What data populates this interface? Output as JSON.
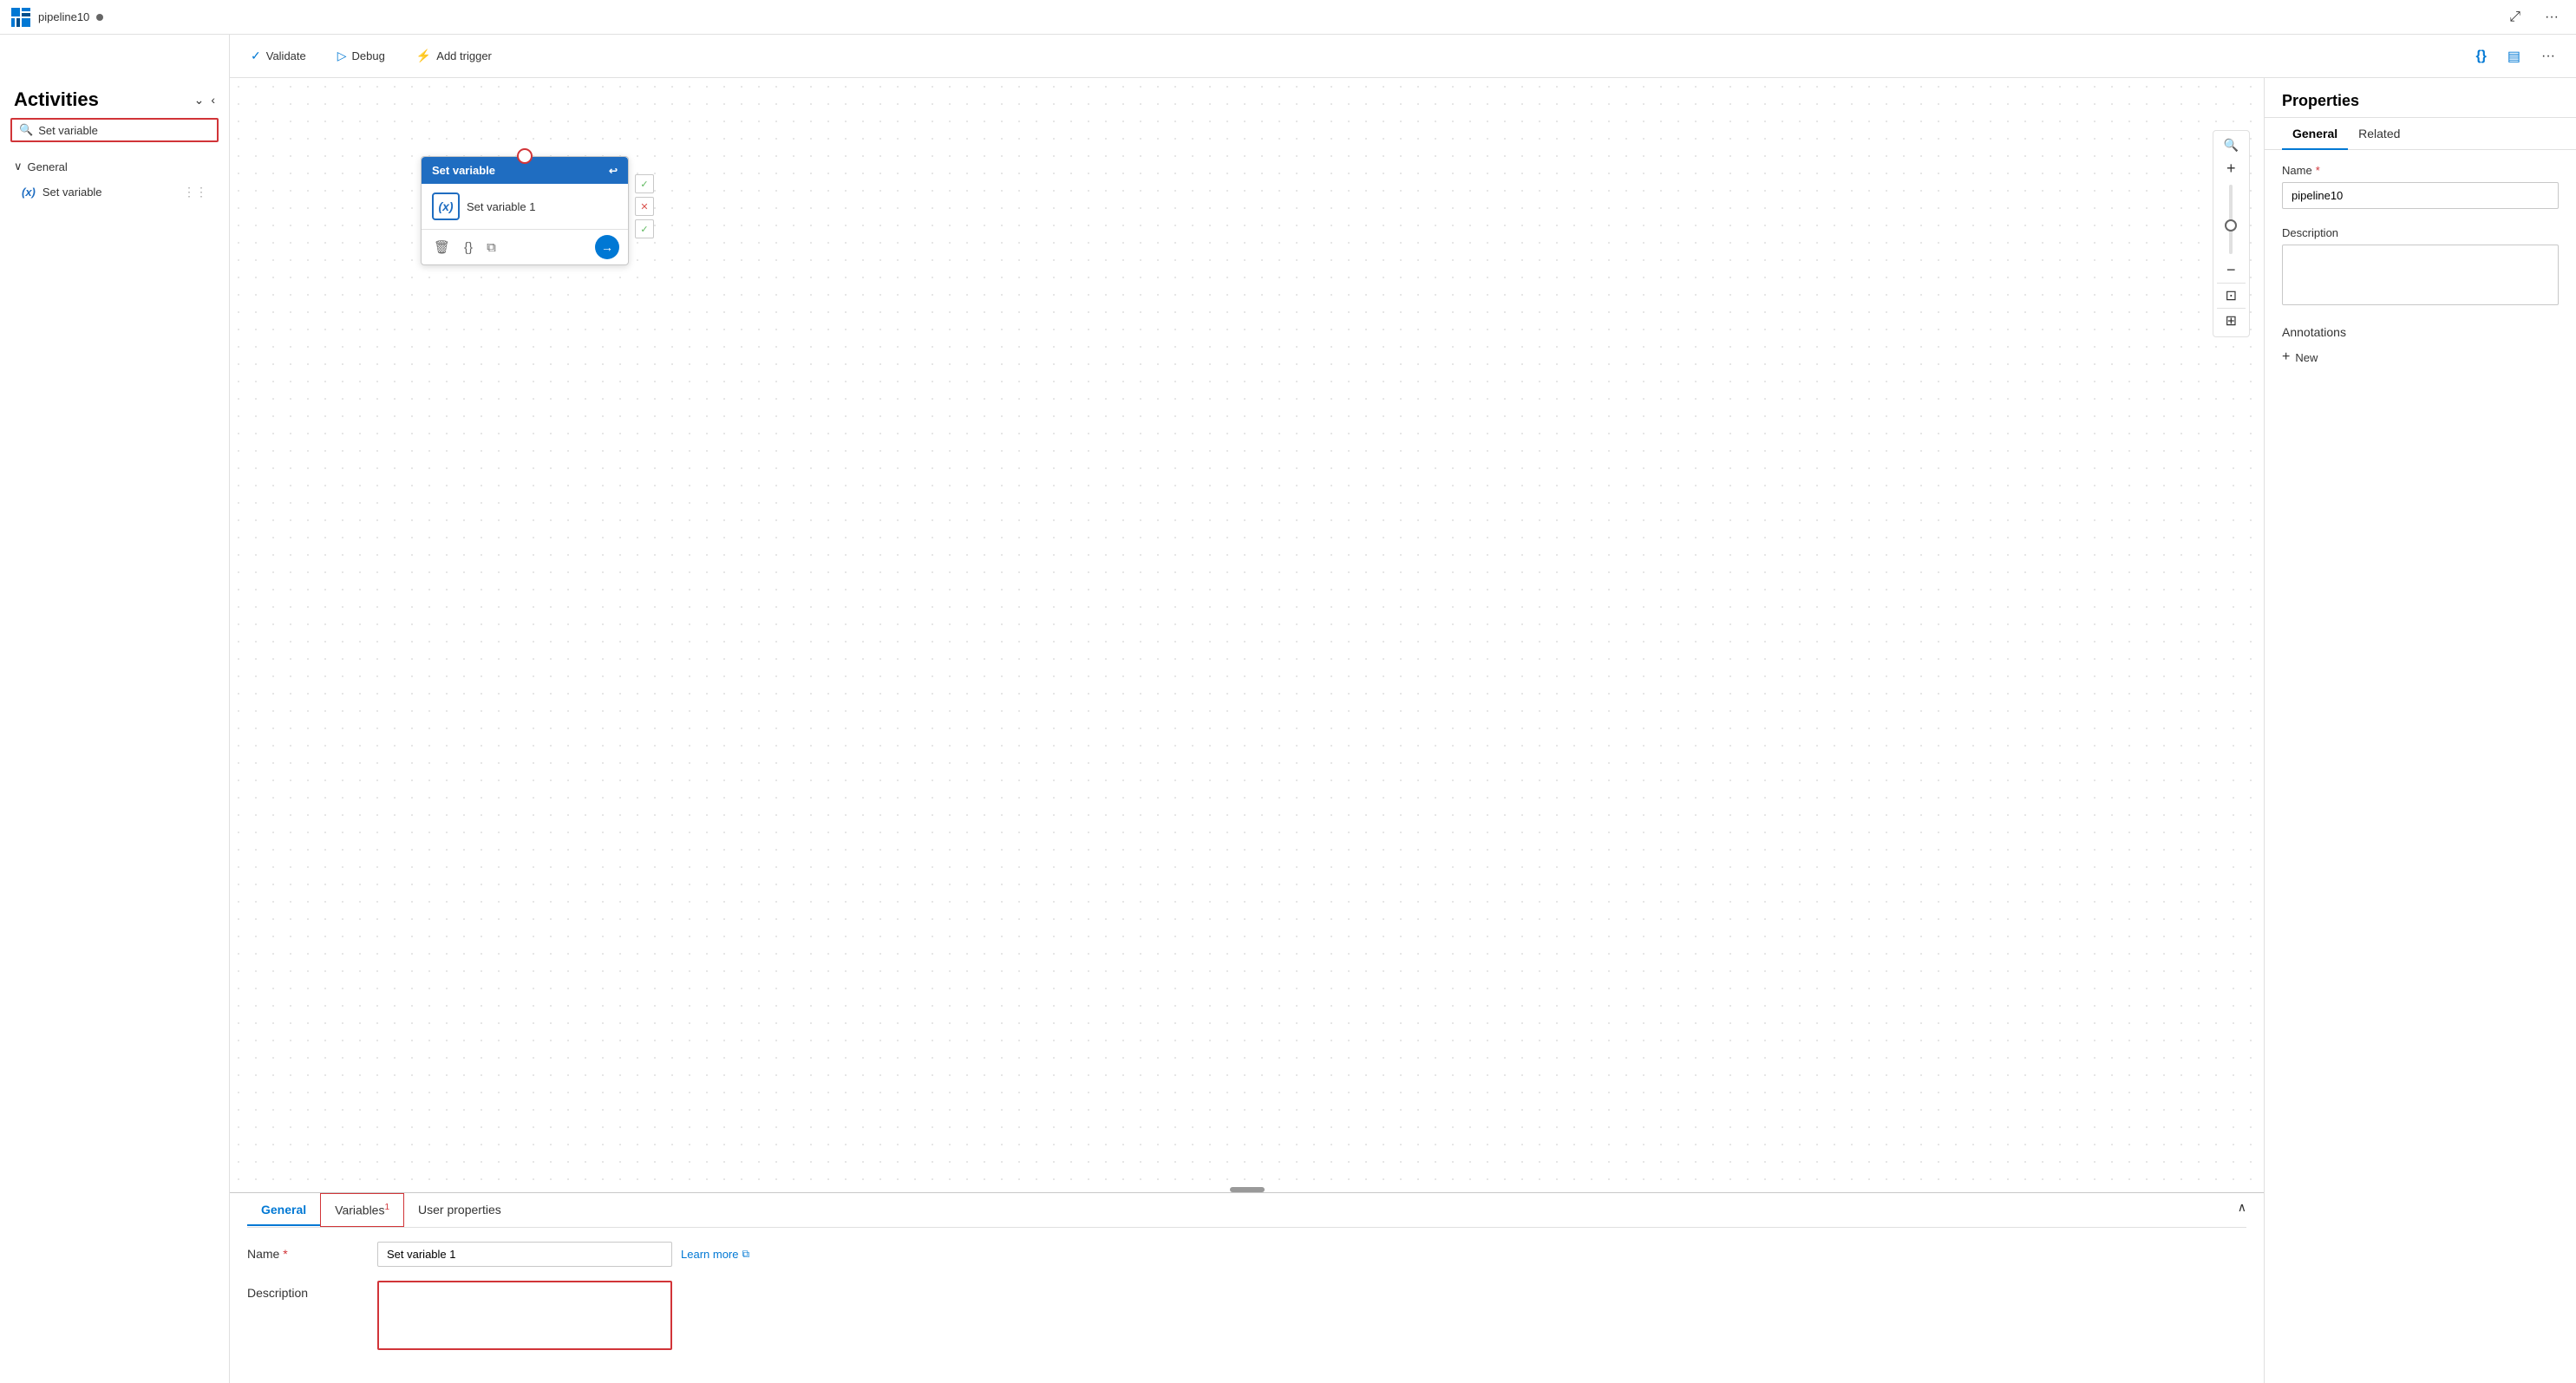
{
  "titlebar": {
    "app_name": "pipeline10",
    "expand_icon": "⤢",
    "more_icon": "···"
  },
  "toolbar": {
    "validate_label": "Validate",
    "debug_label": "Debug",
    "add_trigger_label": "Add trigger",
    "code_icon": "{}",
    "monitor_icon": "▤",
    "more_icon": "···"
  },
  "sidebar": {
    "title": "Activities",
    "collapse_icon": "⌄",
    "chevron_icon": "‹",
    "search_placeholder": "Set variable",
    "search_value": "Set variable",
    "section": {
      "label": "General",
      "items": [
        {
          "label": "Set variable",
          "icon": "(x)"
        }
      ]
    }
  },
  "canvas": {
    "node": {
      "header": "Set variable",
      "body_label": "Set variable 1",
      "body_icon": "(x)"
    }
  },
  "bottom_panel": {
    "tabs": [
      {
        "label": "General",
        "active": true,
        "badge": ""
      },
      {
        "label": "Variables",
        "active": false,
        "badge": "1",
        "bordered": true
      },
      {
        "label": "User properties",
        "active": false,
        "badge": ""
      }
    ],
    "name_label": "Name",
    "name_required": "*",
    "name_value": "Set variable 1",
    "learn_more": "Learn more",
    "description_label": "Description",
    "description_value": ""
  },
  "right_panel": {
    "title": "Properties",
    "tabs": [
      {
        "label": "General",
        "active": true
      },
      {
        "label": "Related",
        "active": false
      }
    ],
    "name_label": "Name",
    "name_required": "*",
    "name_value": "pipeline10",
    "description_label": "Description",
    "description_value": "",
    "annotations_label": "Annotations",
    "new_button_label": "New"
  }
}
